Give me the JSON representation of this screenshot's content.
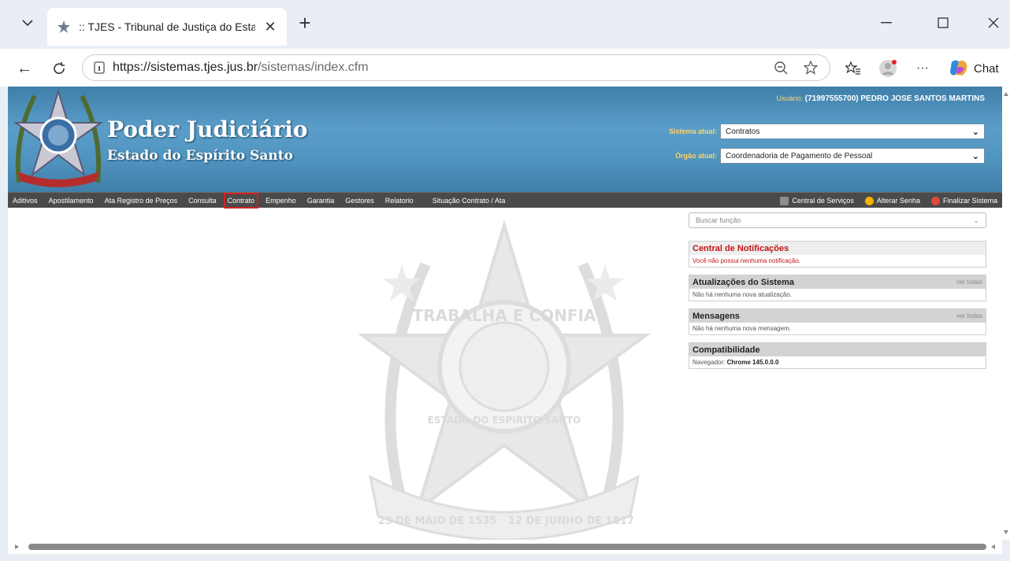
{
  "browser": {
    "tab_title": ":: TJES - Tribunal de Justiça do Esta",
    "url_host": "https://sistemas.tjes.jus.br",
    "url_path": "/sistemas/index.cfm",
    "chat_label": "Chat",
    "new_tab_symbol": "+",
    "tab_close_symbol": "✕",
    "back_symbol": "←",
    "refresh_symbol": "C",
    "more_symbol": "···"
  },
  "header": {
    "title": "Poder Judiciário",
    "subtitle": "Estado do Espírito Santo",
    "user_label": "Usuário:",
    "user_value": "(71997555700) PEDRO JOSE SANTOS MARTINS",
    "system_label": "Sistema atual:",
    "system_value": "Contratos",
    "organ_label": "Órgão atual:",
    "organ_value": "Coordenadoria de Pagamento de Pessoal"
  },
  "menu": {
    "left_items": [
      "Aditivos",
      "Apostilamento",
      "Ata Registro de Preços",
      "Consulta",
      "Contrato",
      "Empenho",
      "Garantia",
      "Gestores",
      "Relatorio",
      "Situação Contrato / Ata"
    ],
    "highlighted_index": 4,
    "right_items": [
      "Central de Serviços",
      "Alterar Senha",
      "Finalizar Sistema"
    ]
  },
  "sidebar": {
    "search_placeholder": "Buscar função",
    "notifications_title": "Central de Notificações",
    "notifications_text": "Você não possui nenhuma notificação.",
    "updates_title": "Atualizações do Sistema",
    "updates_link": "ver todas",
    "updates_text": "Não há nenhuma nova atualização.",
    "messages_title": "Mensagens",
    "messages_link": "ver todas",
    "messages_text": "Não há nenhuma nova mensagem.",
    "compat_title": "Compatibilidade",
    "compat_label": "Navegador:",
    "compat_value": "Chrome 145.0.0.0"
  },
  "watermark": {
    "top_text": "TRABALHA E CONFIA",
    "bottom_text": "ESTADO DO ESPIRITO SANTO",
    "ribbon_left": "23 DE MAIO DE 1535",
    "ribbon_right": "12 DE JUNHO DE 1817"
  },
  "colors": {
    "header_blue": "#4f93bf",
    "menu_bg": "#4a4a4a",
    "highlight_red": "#d42121",
    "notification_red": "#c31414"
  }
}
